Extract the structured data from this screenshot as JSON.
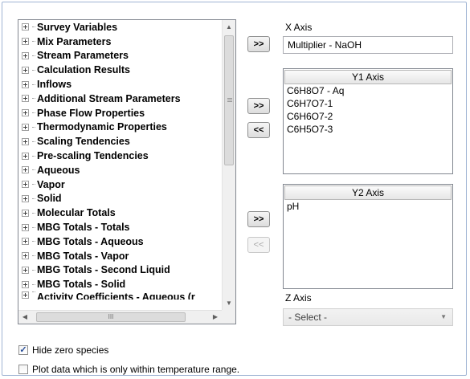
{
  "tree": {
    "items": [
      "Survey Variables",
      "Mix Parameters",
      "Stream Parameters",
      "Calculation Results",
      "Inflows",
      "Additional Stream Parameters",
      "Phase Flow Properties",
      "Thermodynamic Properties",
      "Scaling Tendencies",
      "Pre-scaling Tendencies",
      "Aqueous",
      "Vapor",
      "Solid",
      "Molecular Totals",
      "MBG Totals - Totals",
      "MBG Totals - Aqueous",
      "MBG Totals - Vapor",
      "MBG Totals - Second Liquid",
      "MBG Totals - Solid"
    ],
    "cut_item": "Activity Coefficients - Aqueous (r",
    "scroll_up_icon": "scroll-up-arrow",
    "scroll_down_icon": "scroll-down-arrow",
    "scroll_left_icon": "scroll-left-arrow",
    "scroll_right_icon": "scroll-right-arrow"
  },
  "buttons": {
    "add_x": ">>",
    "add_y1": ">>",
    "remove_y1": "<<",
    "add_y2": ">>",
    "remove_y2": "<<"
  },
  "x_axis": {
    "label": "X Axis",
    "value": "Multiplier - NaOH"
  },
  "y1_axis": {
    "header": "Y1 Axis",
    "items": [
      "C6H8O7 - Aq",
      "C6H7O7-1",
      "C6H6O7-2",
      "C6H5O7-3"
    ]
  },
  "y2_axis": {
    "header": "Y2 Axis",
    "items": [
      "pH"
    ]
  },
  "z_axis": {
    "label": "Z Axis",
    "selected": "- Select -"
  },
  "options": {
    "hide_zero_species": {
      "label": "Hide zero species",
      "checked": true
    },
    "temperature_range": {
      "label": "Plot data which is only within temperature range.",
      "checked": false
    }
  }
}
